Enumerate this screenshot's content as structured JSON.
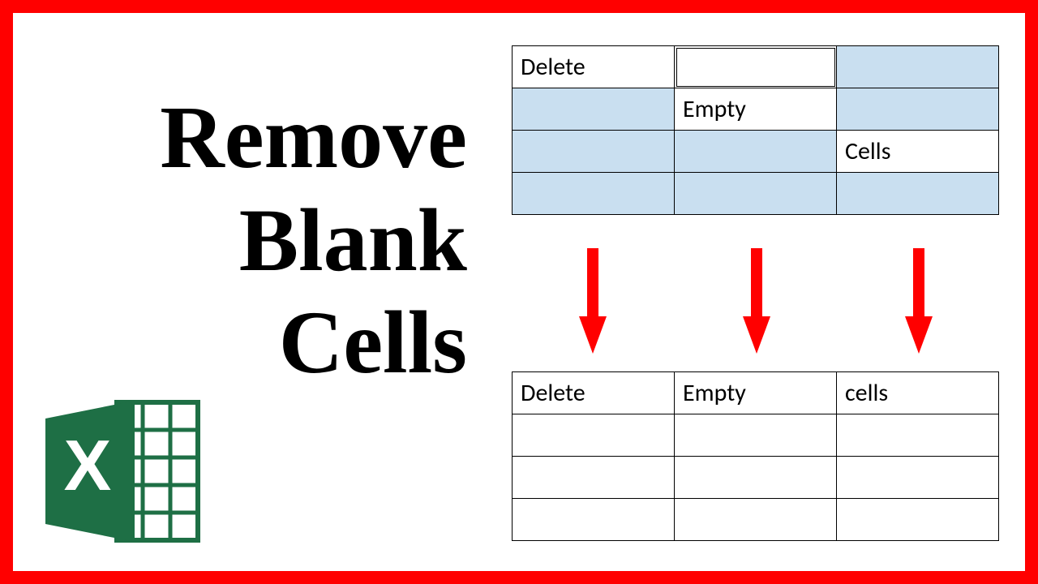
{
  "title": {
    "line1": "Remove",
    "line2": "Blank",
    "line3": "Cells"
  },
  "colors": {
    "frame_border": "#ff0000",
    "selected_cell": "#c9dff0",
    "arrow": "#ff0000",
    "excel_green": "#1e6f45",
    "excel_light": "#ffffff"
  },
  "table_top": {
    "rows": [
      [
        {
          "text": "Delete",
          "selected": false,
          "active": false
        },
        {
          "text": "",
          "selected": false,
          "active": true
        },
        {
          "text": "",
          "selected": true,
          "active": false
        }
      ],
      [
        {
          "text": "",
          "selected": true,
          "active": false
        },
        {
          "text": "Empty",
          "selected": false,
          "active": false
        },
        {
          "text": "",
          "selected": true,
          "active": false
        }
      ],
      [
        {
          "text": "",
          "selected": true,
          "active": false
        },
        {
          "text": "",
          "selected": true,
          "active": false
        },
        {
          "text": "Cells",
          "selected": false,
          "active": false
        }
      ],
      [
        {
          "text": "",
          "selected": true,
          "active": false
        },
        {
          "text": "",
          "selected": true,
          "active": false
        },
        {
          "text": "",
          "selected": true,
          "active": false
        }
      ]
    ]
  },
  "table_bottom": {
    "rows": [
      [
        {
          "text": "Delete"
        },
        {
          "text": "Empty"
        },
        {
          "text": "cells"
        }
      ],
      [
        {
          "text": ""
        },
        {
          "text": ""
        },
        {
          "text": ""
        }
      ],
      [
        {
          "text": ""
        },
        {
          "text": ""
        },
        {
          "text": ""
        }
      ],
      [
        {
          "text": ""
        },
        {
          "text": ""
        },
        {
          "text": ""
        }
      ]
    ]
  },
  "arrow_count": 3,
  "excel_icon": {
    "name": "excel-icon",
    "letter": "X"
  }
}
